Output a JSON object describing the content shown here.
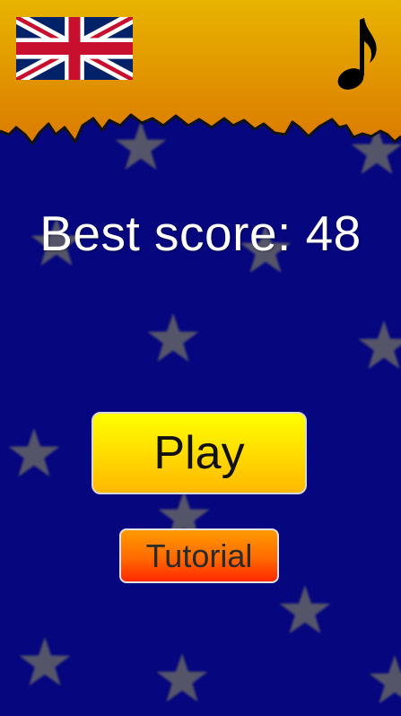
{
  "best_score": {
    "label": "Best score:",
    "value": "48"
  },
  "buttons": {
    "play_label": "Play",
    "tutorial_label": "Tutorial"
  },
  "top_bar": {
    "language_flag": "uk-flag-icon",
    "sound_toggle": "music-note-icon"
  },
  "colors": {
    "background": "#06067e",
    "star": "#55556a",
    "top_bar_gradient_top": "#e8b400",
    "top_bar_gradient_bottom": "#db7a00",
    "play_button_top": "#ffff00",
    "play_button_bottom": "#ffb800",
    "tutorial_button_top": "#ff9a00",
    "tutorial_button_bottom": "#ff2800"
  }
}
